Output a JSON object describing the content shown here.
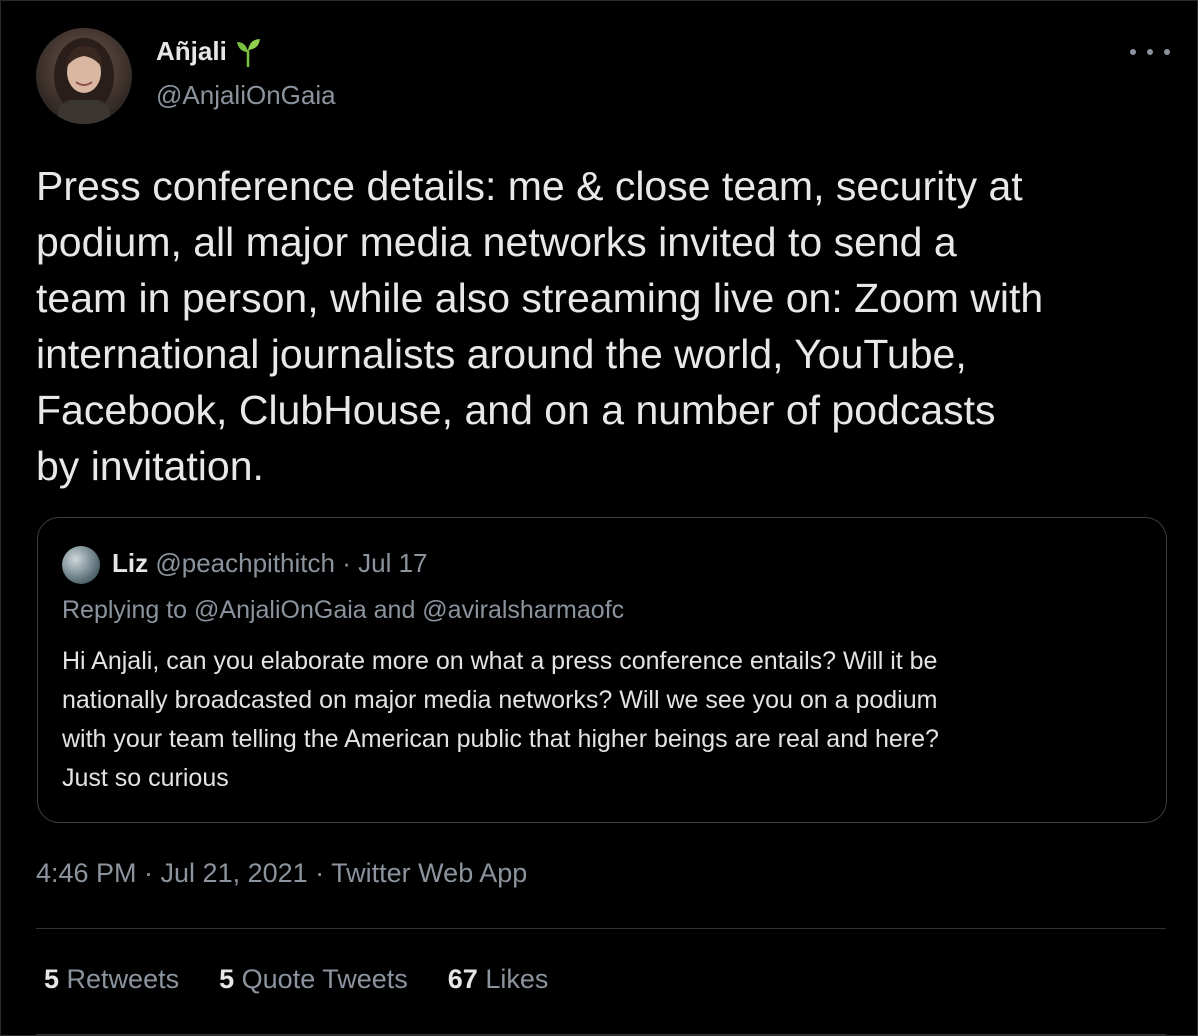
{
  "author": {
    "name": "Añjali",
    "handle": "@AnjaliOnGaia"
  },
  "tweet": {
    "text": "Press conference details: me & close team, security at\npodium, all major media networks invited to send a\nteam in person, while also streaming live on: Zoom with\ninternational journalists around the world, YouTube,\nFacebook, ClubHouse, and on a number of podcasts\nby invitation."
  },
  "quoted": {
    "name": "Liz",
    "handle": "@peachpithitch",
    "separator": "·",
    "date": "Jul 17",
    "replying_to": "Replying to @AnjaliOnGaia and @aviralsharmaofc",
    "text": "Hi Anjali, can you elaborate more on what a press conference entails? Will it be\nnationally broadcasted on major media networks? Will we see you on a podium\nwith your team telling the American public that higher beings are real and here?\nJust so curious"
  },
  "meta": "4:46 PM · Jul 21, 2021 · Twitter Web App",
  "stats": [
    {
      "count": "5",
      "label": "Retweets"
    },
    {
      "count": "5",
      "label": "Quote Tweets"
    },
    {
      "count": "67",
      "label": "Likes"
    }
  ],
  "colors": {
    "background": "#000000",
    "text_primary": "#e8e8e8",
    "text_secondary": "#8b949e",
    "border": "#3a3f44",
    "sprout_green": "#7ac143"
  }
}
